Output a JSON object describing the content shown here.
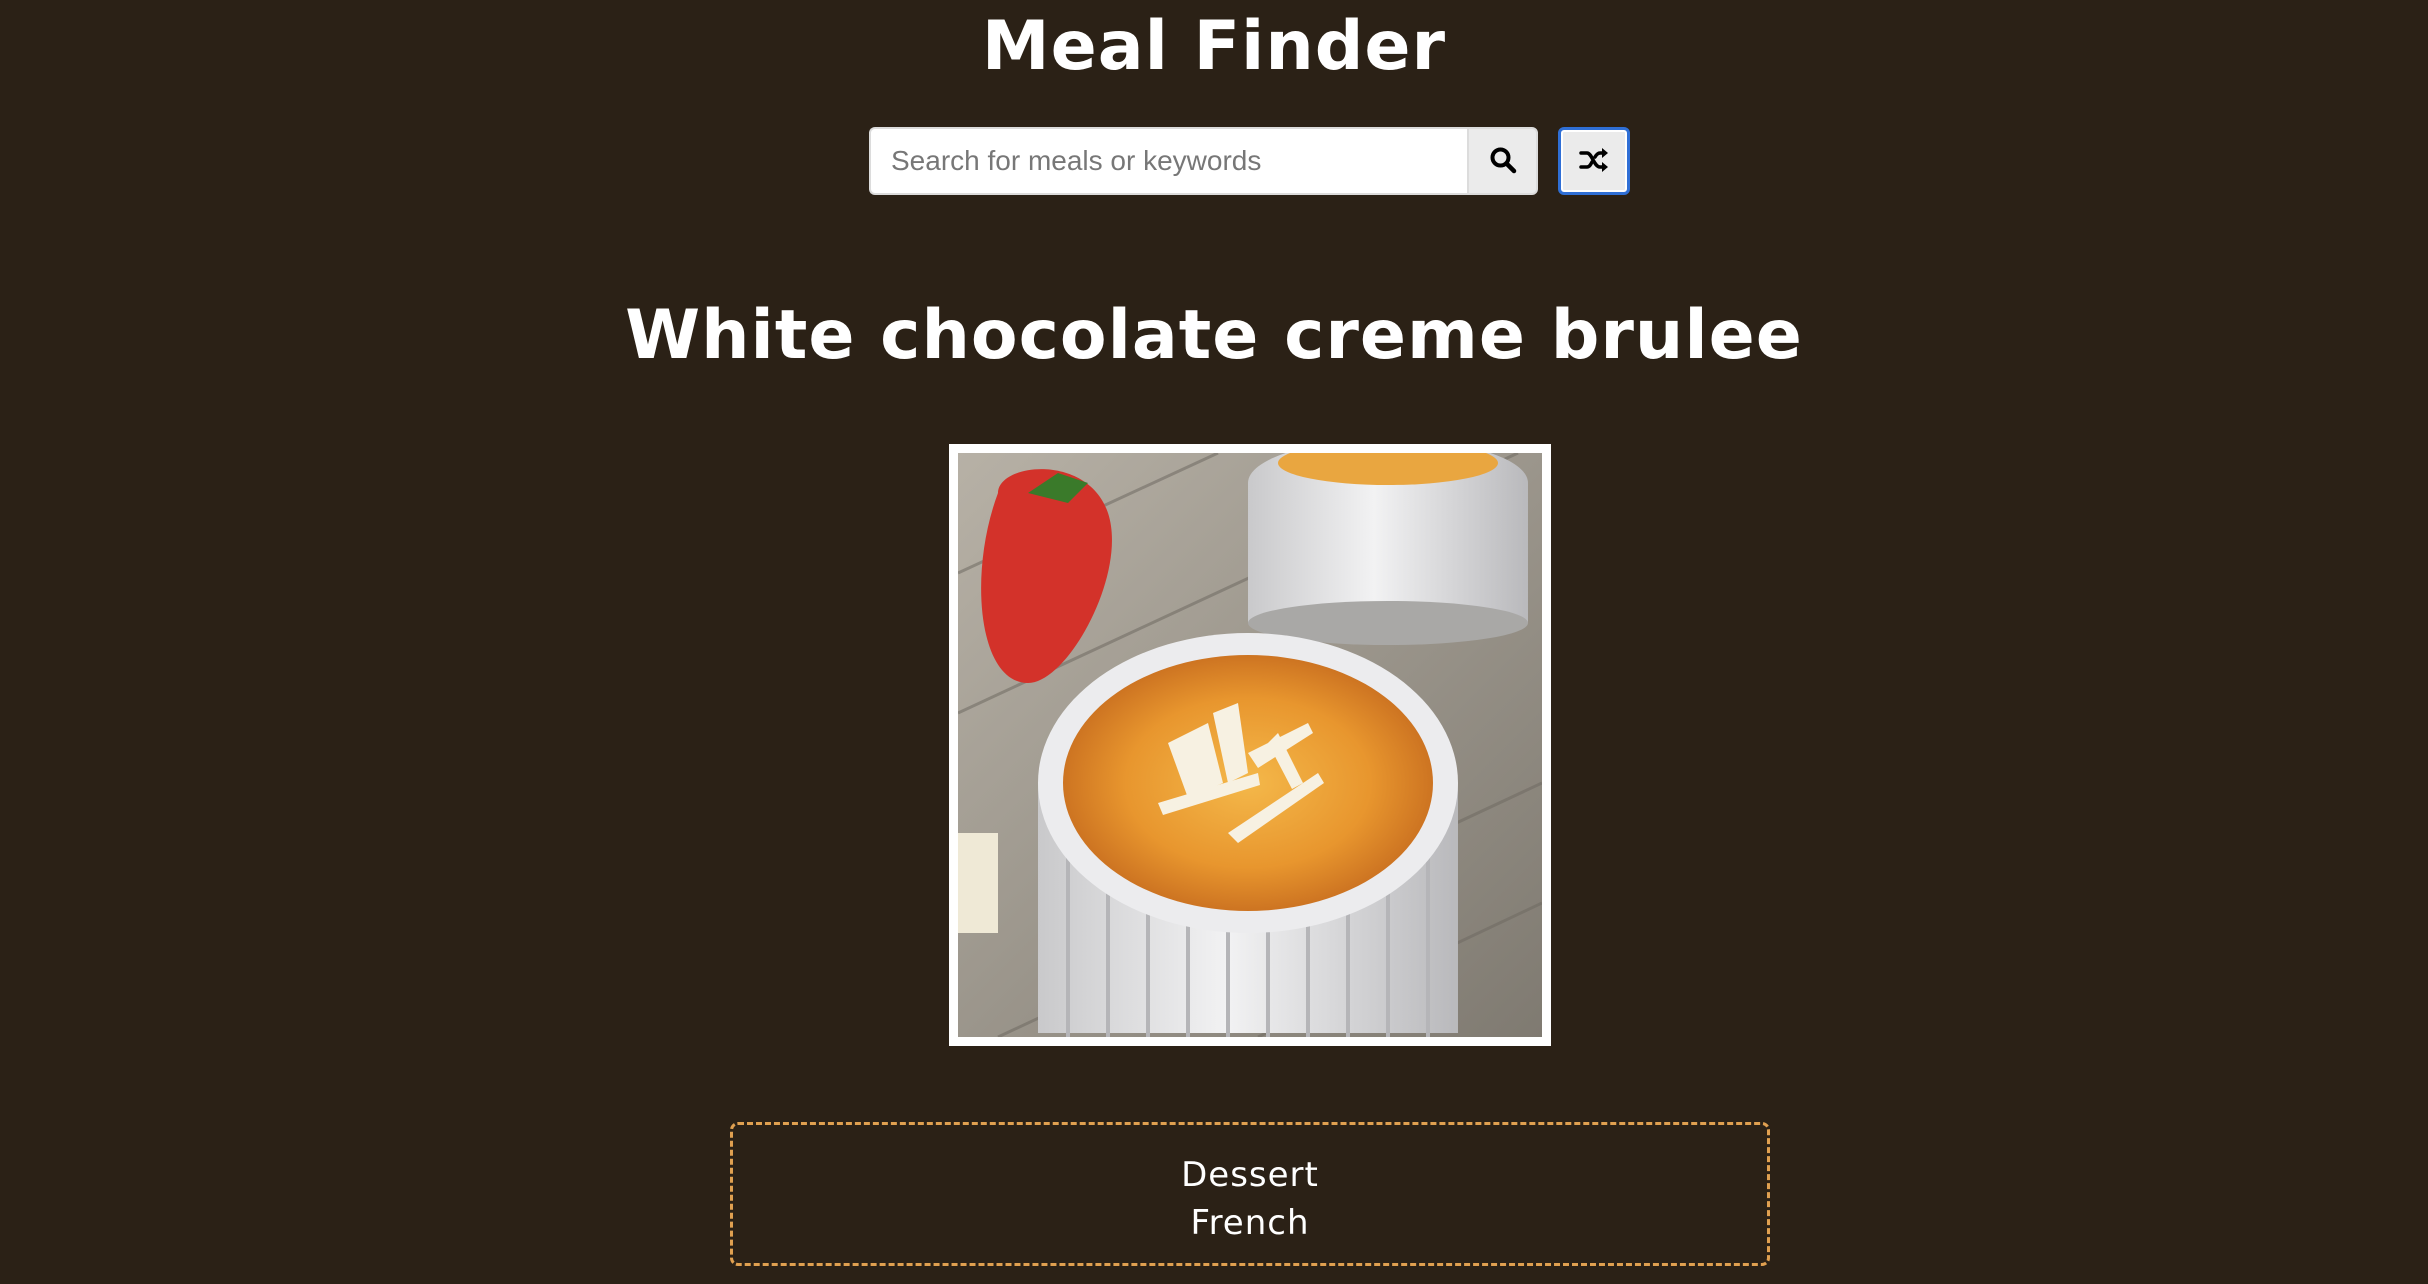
{
  "header": {
    "title": "Meal Finder"
  },
  "search": {
    "placeholder": "Search for meals or keywords",
    "value": "",
    "search_icon": "search-icon",
    "random_icon": "shuffle-icon"
  },
  "meal": {
    "title": "White chocolate creme brulee",
    "image_alt": "White chocolate creme brulee",
    "category": "Dessert",
    "area": "French"
  },
  "colors": {
    "background": "#2b2116",
    "text": "#ffffff",
    "info_border": "#e0a050",
    "focus_ring": "#2f6fd6"
  }
}
